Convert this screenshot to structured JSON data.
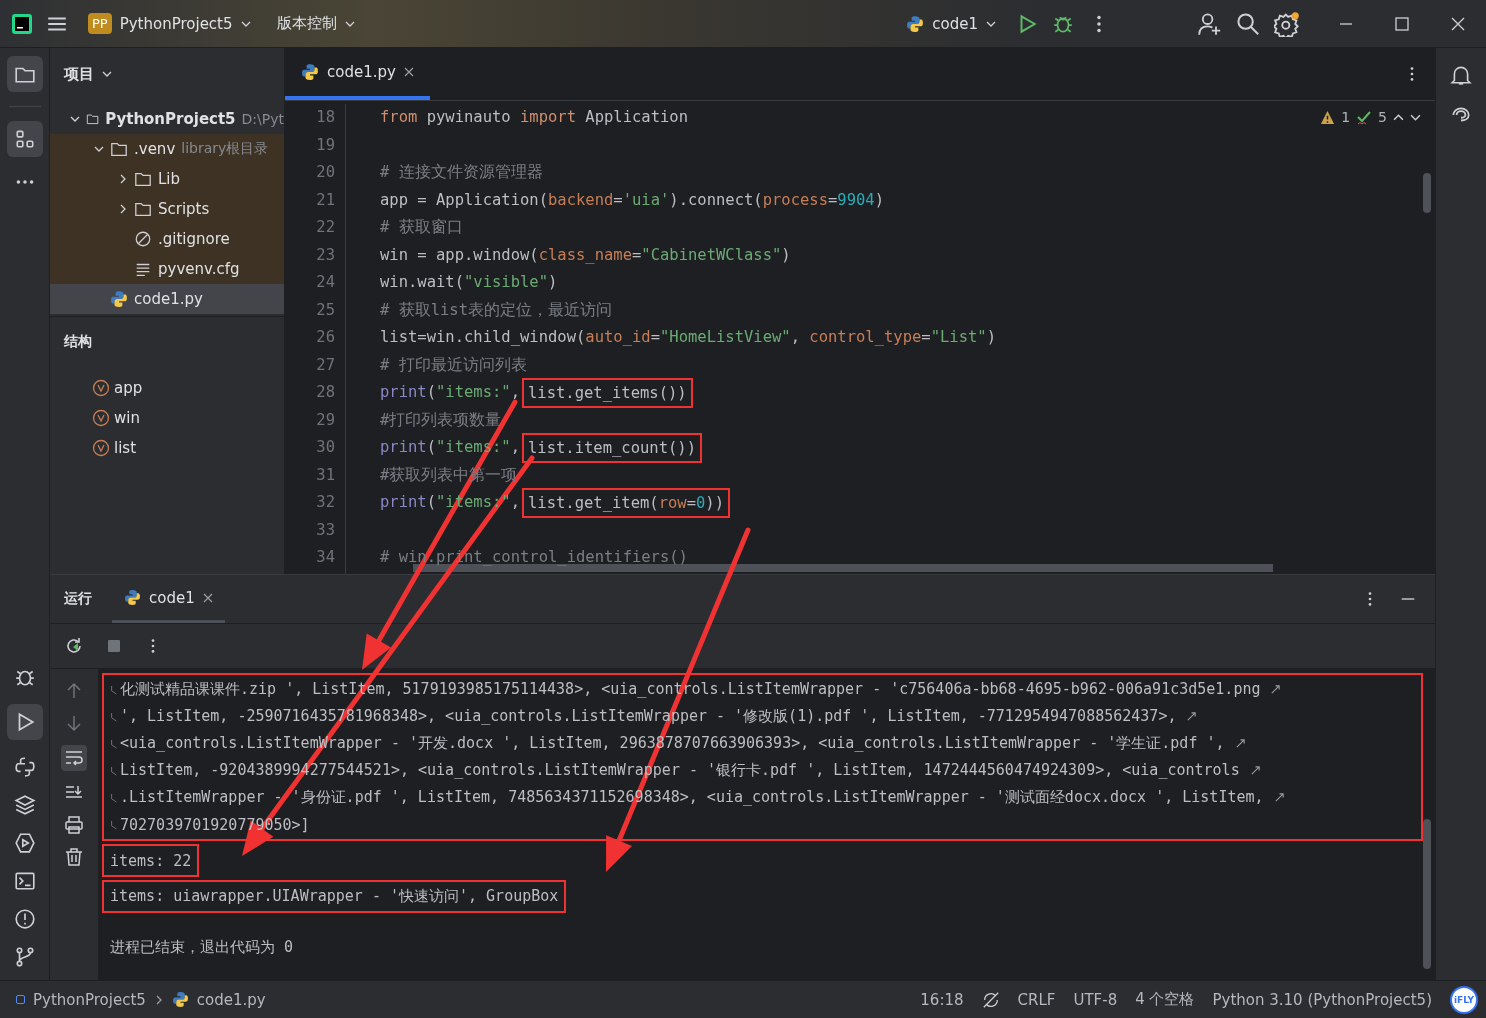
{
  "title_bar": {
    "project_badge": "PP",
    "project": "PythonProject5",
    "vcs": "版本控制",
    "run_config": "code1"
  },
  "project_panel": {
    "title": "项目",
    "tree": [
      {
        "name": "PythonProject5",
        "hint": "D:\\Pyt",
        "kind": "folder",
        "expanded": true,
        "selected": false,
        "children": [
          {
            "name": ".venv",
            "hint": "library根目录",
            "kind": "folder",
            "expanded": true,
            "selected": false,
            "children": [
              {
                "name": "Lib",
                "kind": "folder",
                "expanded": false,
                "selected": false
              },
              {
                "name": "Scripts",
                "kind": "folder",
                "expanded": false,
                "selected": false
              },
              {
                "name": ".gitignore",
                "kind": "ignore",
                "selected": false
              },
              {
                "name": "pyvenv.cfg",
                "kind": "text",
                "selected": false
              }
            ]
          },
          {
            "name": "code1.py",
            "kind": "python",
            "selected": true
          }
        ]
      }
    ]
  },
  "structure_panel": {
    "title": "结构",
    "items": [
      {
        "name": "app"
      },
      {
        "name": "win"
      },
      {
        "name": "list"
      }
    ]
  },
  "editor": {
    "tabs": [
      {
        "label": "code1.py",
        "selected": true
      }
    ],
    "warnings": "1",
    "checks": "5",
    "lines": [
      {
        "number": "18",
        "tokens": [
          {
            "kind": "kw",
            "text": "from"
          },
          {
            "kind": "id",
            "text": " pywinauto "
          },
          {
            "kind": "kw",
            "text": "import"
          },
          {
            "kind": "id",
            "text": " Application"
          }
        ]
      },
      {
        "number": "19"
      },
      {
        "number": "20",
        "tokens": [
          {
            "kind": "cm",
            "text": "# 连接文件资源管理器"
          }
        ]
      },
      {
        "number": "21",
        "tokens": [
          {
            "kind": "id",
            "text": "app = Application("
          },
          {
            "kind": "pa",
            "text": "backend"
          },
          {
            "kind": "id",
            "text": "="
          },
          {
            "kind": "st",
            "text": "'uia'"
          },
          {
            "kind": "id",
            "text": ").connect("
          },
          {
            "kind": "pa",
            "text": "process"
          },
          {
            "kind": "id",
            "text": "="
          },
          {
            "kind": "nu",
            "text": "9904"
          },
          {
            "kind": "id",
            "text": ")"
          }
        ]
      },
      {
        "number": "22",
        "tokens": [
          {
            "kind": "cm",
            "text": "# 获取窗口"
          }
        ]
      },
      {
        "number": "23",
        "tokens": [
          {
            "kind": "id",
            "text": "win = app.window("
          },
          {
            "kind": "pa",
            "text": "class_name"
          },
          {
            "kind": "id",
            "text": "="
          },
          {
            "kind": "st",
            "text": "\"CabinetWClass\""
          },
          {
            "kind": "id",
            "text": ")"
          }
        ]
      },
      {
        "number": "24",
        "tokens": [
          {
            "kind": "id",
            "text": "win.wait("
          },
          {
            "kind": "st",
            "text": "\"visible\""
          },
          {
            "kind": "id",
            "text": ")"
          }
        ]
      },
      {
        "number": "25",
        "tokens": [
          {
            "kind": "cm",
            "text": "# 获取list表的定位，最近访问"
          }
        ]
      },
      {
        "number": "26",
        "tokens": [
          {
            "kind": "id",
            "text": "list=win.child_window("
          },
          {
            "kind": "pa",
            "text": "auto_id"
          },
          {
            "kind": "id",
            "text": "="
          },
          {
            "kind": "st",
            "text": "\"HomeListView\""
          },
          {
            "kind": "id",
            "text": ", "
          },
          {
            "kind": "pa",
            "text": "control_type"
          },
          {
            "kind": "id",
            "text": "="
          },
          {
            "kind": "st",
            "text": "\"List\""
          },
          {
            "kind": "id",
            "text": ")"
          }
        ]
      },
      {
        "number": "27",
        "tokens": [
          {
            "kind": "cm",
            "text": "# 打印最近访问列表"
          }
        ]
      },
      {
        "number": "28",
        "tokens": [
          {
            "kind": "bi",
            "text": "print"
          },
          {
            "kind": "id",
            "text": "("
          },
          {
            "kind": "st",
            "text": "\"items:\""
          },
          {
            "kind": "id",
            "text": ","
          }
        ],
        "boxed_tokens": [
          {
            "kind": "id",
            "text": "list.get_items())"
          }
        ]
      },
      {
        "number": "29",
        "tokens": [
          {
            "kind": "cm",
            "text": "#打印列表项数量"
          }
        ]
      },
      {
        "number": "30",
        "tokens": [
          {
            "kind": "bi",
            "text": "print"
          },
          {
            "kind": "id",
            "text": "("
          },
          {
            "kind": "st",
            "text": "\"items:\""
          },
          {
            "kind": "id",
            "text": ","
          }
        ],
        "boxed_tokens": [
          {
            "kind": "id",
            "text": "list.item_count())"
          }
        ]
      },
      {
        "number": "31",
        "tokens": [
          {
            "kind": "cm",
            "text": "#获取列表中第一项"
          }
        ]
      },
      {
        "number": "32",
        "tokens": [
          {
            "kind": "bi",
            "text": "print"
          },
          {
            "kind": "id",
            "text": "("
          },
          {
            "kind": "st",
            "text": "\"items:\""
          },
          {
            "kind": "id",
            "text": ","
          }
        ],
        "boxed_tokens": [
          {
            "kind": "id",
            "text": "list.get_item("
          },
          {
            "kind": "pa",
            "text": "row"
          },
          {
            "kind": "id",
            "text": "="
          },
          {
            "kind": "nu",
            "text": "0"
          },
          {
            "kind": "id",
            "text": "))"
          }
        ]
      },
      {
        "number": "33"
      },
      {
        "number": "34",
        "tokens": [
          {
            "kind": "cm",
            "text": "# win.print_control_identifiers()"
          }
        ]
      }
    ]
  },
  "run_panel": {
    "title": "运行",
    "tabs": [
      {
        "label": "code1",
        "selected": true
      }
    ],
    "output": [
      {
        "boxed": true,
        "lines": [
          {
            "text": "化测试精品课课件.zip ', ListItem, 5179193985175114438>, <uia_controls.ListItemWrapper - 'c756406a-bb68-4695-b962-006a91c3d5e1.png",
            "continued": true,
            "wraps": true
          },
          {
            "text": "', ListItem, -2590716435781968348>, <uia_controls.ListItemWrapper - '修改版(1).pdf ', ListItem, -7712954947088562437>,",
            "continued": true,
            "wraps": true
          },
          {
            "text": "<uia_controls.ListItemWrapper - '开发.docx ', ListItem, 2963878707663906393>, <uia_controls.ListItemWrapper - '学生证.pdf ',",
            "continued": true,
            "wraps": true
          },
          {
            "text": "ListItem, -9204389994277544521>, <uia_controls.ListItemWrapper - '银行卡.pdf ', ListItem, 1472444560474924309>, <uia_controls",
            "continued": true,
            "wraps": true
          },
          {
            "text": ".ListItemWrapper - '身份证.pdf ', ListItem, 7485634371152698348>, <uia_controls.ListItemWrapper - '测试面经docx.docx ', ListItem,",
            "continued": true,
            "wraps": true
          },
          {
            "text": "7027039701920779050>]",
            "continued": true,
            "wraps": false
          }
        ]
      },
      {
        "boxed": true,
        "lines": [
          {
            "text": "items: 22",
            "continued": false,
            "wraps": false
          }
        ]
      },
      {
        "boxed": true,
        "lines": [
          {
            "text": "items: uiawrapper.UIAWrapper - '快速访问', GroupBox",
            "continued": false,
            "wraps": false
          }
        ]
      },
      {
        "boxed": false,
        "lines": [
          {
            "text": "进程已结束，退出代码为 0",
            "continued": false,
            "wraps": false
          }
        ]
      }
    ]
  },
  "status_bar": {
    "breadcrumbs": [
      "PythonProject5",
      "code1.py"
    ],
    "position": "16:18",
    "line_separator": "CRLF",
    "encoding": "UTF-8",
    "indent": "4 个空格",
    "interpreter": "Python 3.10 (PythonProject5)",
    "ime_badge": "iFLY"
  }
}
